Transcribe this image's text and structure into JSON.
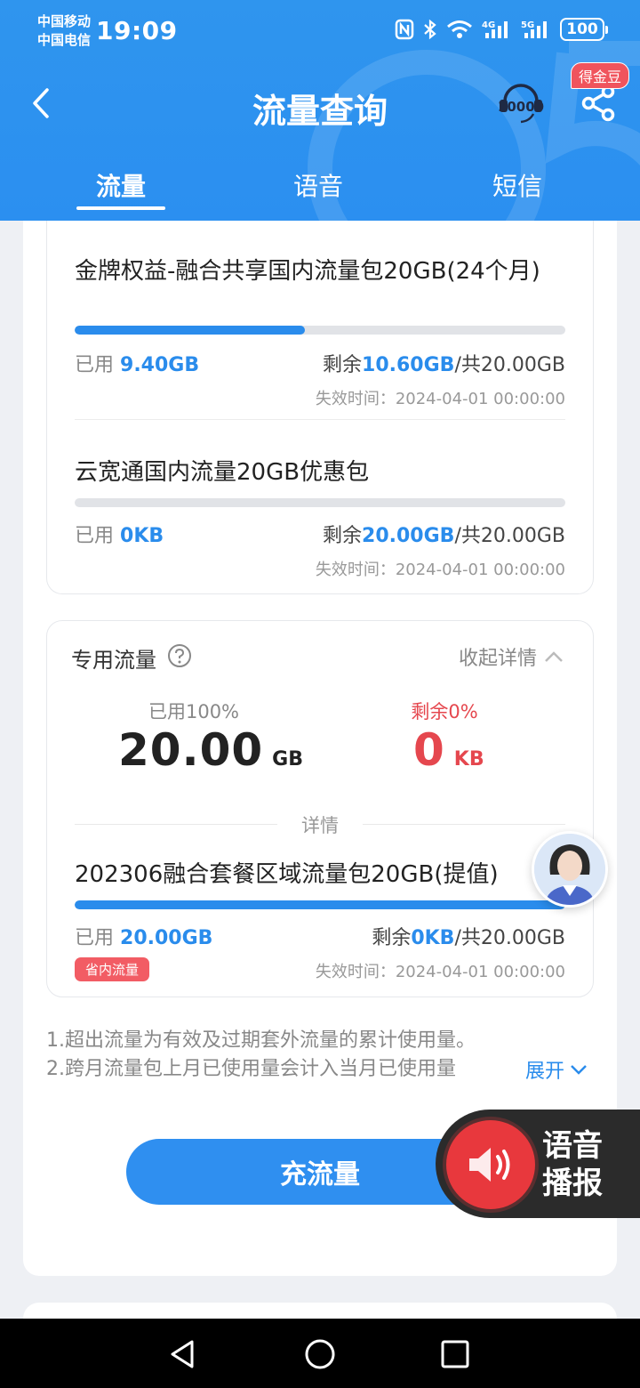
{
  "status_bar": {
    "carrier1": "中国移动",
    "carrier2": "中国电信",
    "time": "19:09",
    "battery": "100",
    "icons": [
      "nfc-icon",
      "bluetooth-icon",
      "wifi-icon",
      "signal-4g-icon",
      "signal-5g-icon"
    ]
  },
  "header": {
    "title": "流量查询",
    "service_icon": "10000",
    "badge": "得金豆",
    "tabs": [
      "流量",
      "语音",
      "短信"
    ],
    "active_tab": 0,
    "accent": "#2b8ff0"
  },
  "packages": [
    {
      "name": "金牌权益-融合共享国内流量包20GB(24个月)",
      "used_label": "已用",
      "used": "9.40GB",
      "remain_label": "剩余",
      "remain": "10.60GB",
      "total": "/共20.00GB",
      "progress": 0.47,
      "expire_label": "失效时间：",
      "expire": "2024-04-01 00:00:00"
    },
    {
      "name": "云宽通国内流量20GB优惠包",
      "used_label": "已用",
      "used": "0KB",
      "remain_label": "剩余",
      "remain": "20.00GB",
      "total": "/共20.00GB",
      "progress": 0,
      "expire_label": "失效时间：",
      "expire": "2024-04-01 00:00:00"
    }
  ],
  "special": {
    "title": "专用流量",
    "collapse": "收起详情",
    "used_label": "已用100%",
    "used_value": "20.00",
    "used_unit": "GB",
    "remain_label": "剩余0%",
    "remain_value": "0",
    "remain_unit": "KB",
    "detail": "详情",
    "remain_color": "#e5474e",
    "package": {
      "name": "202306融合套餐区域流量包20GB(提值)",
      "used_label": "已用",
      "used": "20.00GB",
      "remain_label": "剩余",
      "remain": "0KB",
      "total": "/共20.00GB",
      "progress": 1.0,
      "tag": "省内流量",
      "expire_label": "失效时间：",
      "expire": "2024-04-01 00:00:00"
    }
  },
  "notes": {
    "line1": "1.超出流量为有效及过期套外流量的累计使用量。",
    "line2": "2.跨月流量包上月已使用量会计入当月已使用量",
    "expand": "展开"
  },
  "recharge": "充流量",
  "voice": {
    "line1": "语音",
    "line2": "播报"
  }
}
